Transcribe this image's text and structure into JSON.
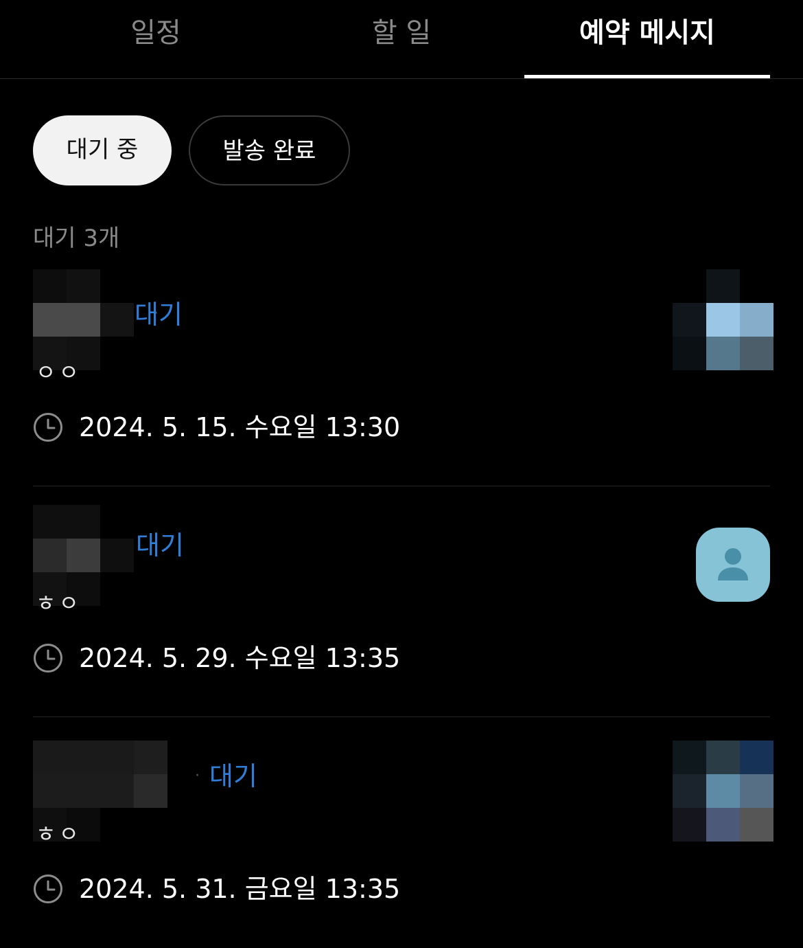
{
  "tabs": [
    {
      "label": "일정"
    },
    {
      "label": "할 일"
    },
    {
      "label": "예약 메시지"
    }
  ],
  "filters": [
    {
      "label": "대기 중",
      "selected": true
    },
    {
      "label": "발송 완료",
      "selected": false
    }
  ],
  "count_label": "대기 3개",
  "items": [
    {
      "status": "대기",
      "initials": "ㅇㅇ",
      "time": "2024. 5. 15. 수요일 13:30",
      "thumbnail": "blurred-photo"
    },
    {
      "status": "대기",
      "initials": "ㅎㅇ",
      "time": "2024. 5. 29. 수요일 13:35",
      "thumbnail": "default-person-icon"
    },
    {
      "status": "대기",
      "initials": "ㅎㅇ",
      "time": "2024. 5. 31. 금요일 13:35",
      "thumbnail": "blurred-photo"
    }
  ],
  "colors": {
    "status_blue": "#2f7ed8",
    "avatar_bg": "#86c3d6",
    "avatar_icon": "#4a8fa8"
  }
}
